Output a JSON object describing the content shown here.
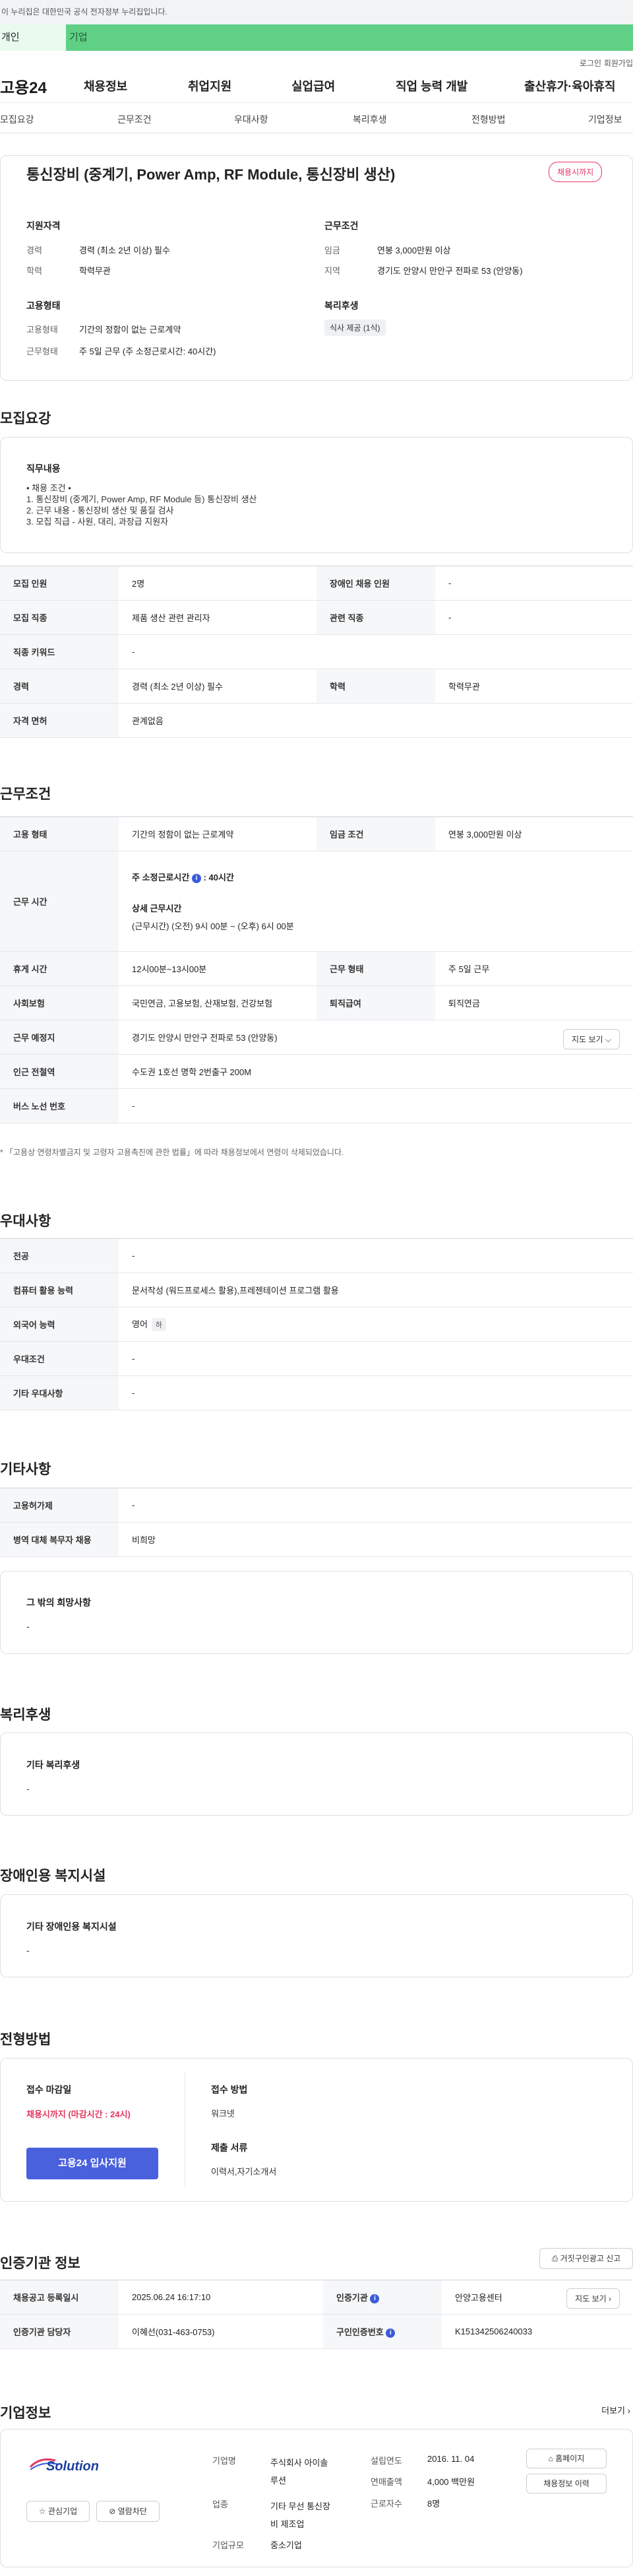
{
  "top_notice": "이 누리집은 대한민국 공식 전자정부 누리집입니다.",
  "tabs": {
    "personal": "개인",
    "company": "기업"
  },
  "util": {
    "login": "로그인",
    "join": "회원가입"
  },
  "logo": "고용24",
  "gnb": [
    "채용정보",
    "취업지원",
    "실업급여",
    "직업 능력 개발",
    "출산휴가·육아휴직"
  ],
  "subnav": [
    "모집요강",
    "근무조건",
    "우대사항",
    "복리후생",
    "전형방법",
    "기업정보"
  ],
  "job": {
    "title": "통신장비 (중계기, Power Amp, RF Module, 통신장비 생산)",
    "status_badge": "채용시까지",
    "qual_head": "지원자격",
    "qual": [
      [
        "경력",
        "경력 (최소 2년 이상) 필수"
      ],
      [
        "학력",
        "학력무관"
      ]
    ],
    "cond_head": "근무조건",
    "cond": [
      [
        "임금",
        "연봉 3,000만원 이상"
      ],
      [
        "지역",
        "경기도 안양시 만안구 전파로 53 (안양동)"
      ]
    ],
    "emp_head": "고용형태",
    "emp": [
      [
        "고용형태",
        "기간의 정함이 없는 근로계약"
      ],
      [
        "근무형태",
        "주 5일 근무 (주 소정근로시간: 40시간)"
      ]
    ],
    "welfare_head": "복리후생",
    "welfare_chip": "식사 제공 (1식)"
  },
  "recruit": {
    "title": "모집요강",
    "duty_head": "직무내용",
    "duty_lines": [
      "• 채용 조건 •",
      "1. 통신장비 (중계기, Power  Amp, RF Module 등) 통신장비 생산",
      "2. 근무 내용 - 통신장비 생산 및 품질 검사",
      "3. 모집 직급 - 사원, 대리, 과장급 지원자"
    ],
    "rows": [
      [
        "모집 인원",
        "2명",
        "장애인 채용 인원",
        "-"
      ],
      [
        "모집 직종",
        "제품 생산 관련 관리자",
        "관련 직종",
        "-"
      ],
      [
        "직종 키워드",
        "-"
      ],
      [
        "경력",
        "경력 (최소 2년 이상) 필수",
        "학력",
        "학력무관"
      ],
      [
        "자격 면허",
        "관계없음"
      ]
    ]
  },
  "work": {
    "title": "근무조건",
    "emp_type_k": "고용 형태",
    "emp_type_v": "기간의 정함이 없는 근로계약",
    "wage_k": "임금 조건",
    "wage_v": "연봉 3,000만원 이상",
    "hours_k": "근무 시간",
    "hours_weekly": "주 소정근로시간",
    "hours_weekly_v": ": 40시간",
    "hours_detail_head": "상세 근무시간",
    "hours_detail": "(근무시간) (오전) 9시 00분 ~ (오후) 6시 00분",
    "break_k": "휴게 시간",
    "break_v": "12시00분~13시00분",
    "shift_k": "근무 형태",
    "shift_v": "주 5일 근무",
    "ins_k": "사회보험",
    "ins_v": "국민연금, 고용보험, 산재보험, 건강보험",
    "ret_k": "퇴직급여",
    "ret_v": "퇴직연금",
    "place_k": "근무 예정지",
    "place_v": "경기도 안양시 만안구 전파로 53 (안양동)",
    "map_btn": "지도 보기",
    "subway_k": "인근 전철역",
    "subway_v": "수도권 1호선 명학 2번출구 200M",
    "bus_k": "버스 노선 번호",
    "bus_v": "-",
    "note": "* 「고용상 연령차별금지 및 고령자 고용촉진에 관한 법률」에 따라 채용정보에서 연령이 삭제되었습니다."
  },
  "pref": {
    "title": "우대사항",
    "rows": [
      [
        "전공",
        "-"
      ],
      [
        "컴퓨터 활용 능력",
        "문서작성 (워드프로세스 활용),프레젠테이션 프로그램 활용"
      ],
      [
        "외국어 능력",
        "영어"
      ],
      [
        "우대조건",
        "-"
      ],
      [
        "기타 우대사항",
        "-"
      ]
    ],
    "lang_tag": "하"
  },
  "etc": {
    "title": "기타사항",
    "rows": [
      [
        "고용허가제",
        "-"
      ],
      [
        "병역 대체 복무자 채용",
        "비희망"
      ]
    ],
    "other_head": "그 밖의 희망사항",
    "other_val": "-"
  },
  "welfare": {
    "title": "복리후생",
    "head": "기타 복리후생",
    "val": "-"
  },
  "disabled": {
    "title": "장애인용 복지시설",
    "head": "기타 장애인용 복지시설",
    "val": "-"
  },
  "selection": {
    "title": "전형방법",
    "deadline_head": "접수 마감일",
    "deadline_val": "채용시까지 (마감시간 : 24시)",
    "apply_btn": "고용24 입사지원",
    "method_head": "접수 방법",
    "method_val": "워크넷",
    "docs_head": "제출 서류",
    "docs_val": "이력서,자기소개서"
  },
  "cert": {
    "title": "인증기관 정보",
    "report_btn": "거짓구인광고 신고",
    "rows": [
      [
        "채용공고 등록일시",
        "2025.06.24 16:17:10",
        "인증기관",
        "안양고용센터"
      ],
      [
        "인증기관 담당자",
        "이혜선(031-463-0753)",
        "구인인증번호",
        "K151342506240033"
      ]
    ],
    "map_btn": "지도 보기"
  },
  "company": {
    "title": "기업정보",
    "more": "더보기",
    "logo_text": "Solution",
    "interest_btn": "관심기업",
    "block_btn": "열람차단",
    "name_k": "기업명",
    "name_v": [
      "주식회사 아이솔",
      "루션"
    ],
    "industry_k": "업종",
    "industry_v": [
      "기타 무선 통신장",
      "비 제조업"
    ],
    "size_k": "기업규모",
    "size_v": "중소기업",
    "founded_k": "설립연도",
    "founded_v": "2016. 11. 04",
    "sales_k": "연매출액",
    "sales_v": "4,000 백만원",
    "emp_k": "근로자수",
    "emp_v": "8명",
    "home_btn": "홈페이지",
    "history_btn": "채용정보 이력"
  },
  "colors": {
    "accent": "#4a61dd",
    "green": "#60d086",
    "red": "#e5355f"
  }
}
